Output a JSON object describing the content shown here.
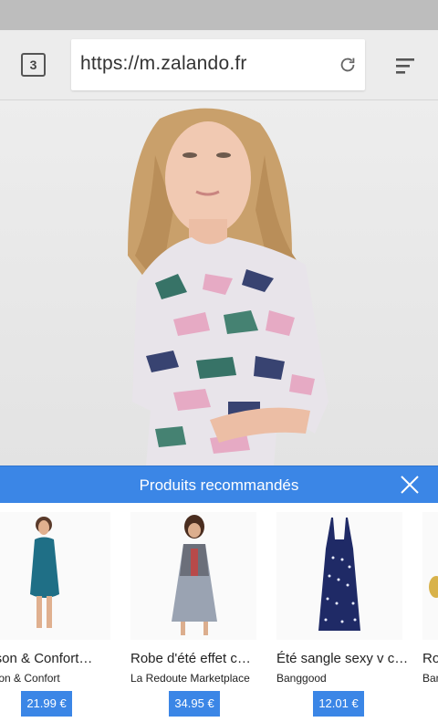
{
  "browser": {
    "tab_count": "3",
    "url": "https://m.zalando.fr",
    "icons": {
      "reload": "reload-icon",
      "menu": "menu-icon"
    }
  },
  "recommendations": {
    "title": "Produits recommandés",
    "products": [
      {
        "name": "aison & Confort…",
        "store": "aison & Confort",
        "price": "21.99 €"
      },
      {
        "name": "Robe d'été effet c…",
        "store": "La Redoute Marketplace",
        "price": "34.95 €"
      },
      {
        "name": "Été sangle sexy v c…",
        "store": "Banggood",
        "price": "12.01 €"
      },
      {
        "name": "Ro",
        "store": "Ban",
        "price": ""
      }
    ]
  },
  "colors": {
    "accent": "#3b86e6"
  }
}
